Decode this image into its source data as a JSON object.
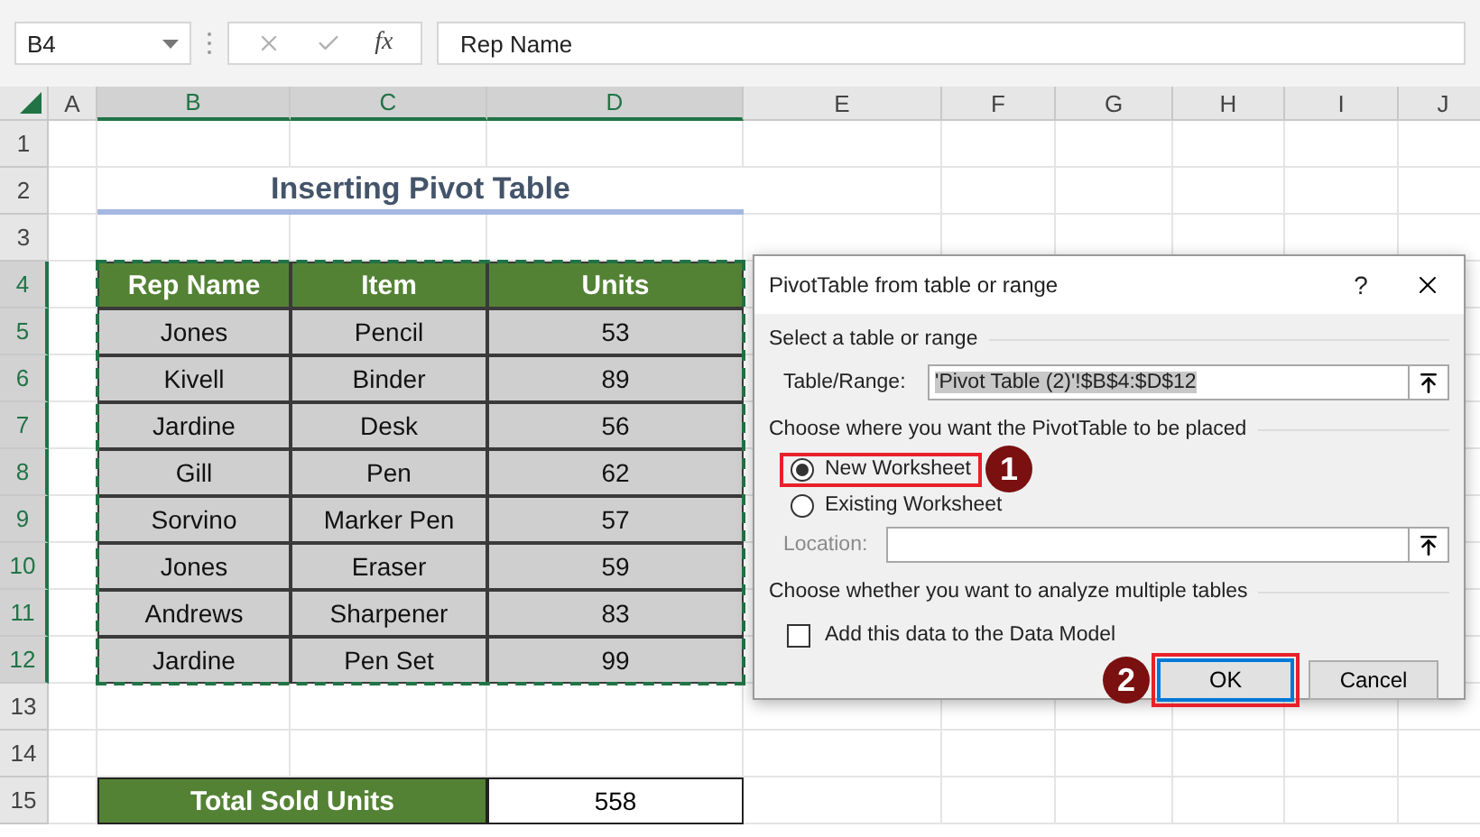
{
  "name_box": "B4",
  "function_label": "fx",
  "formula": "Rep Name",
  "columns": [
    {
      "label": "A",
      "selected": false
    },
    {
      "label": "B",
      "selected": true
    },
    {
      "label": "C",
      "selected": true
    },
    {
      "label": "D",
      "selected": true
    },
    {
      "label": "E",
      "selected": false
    },
    {
      "label": "F",
      "selected": false
    },
    {
      "label": "G",
      "selected": false
    },
    {
      "label": "H",
      "selected": false
    },
    {
      "label": "I",
      "selected": false
    },
    {
      "label": "J",
      "selected": false
    }
  ],
  "rows": [
    {
      "label": "1",
      "selected": false
    },
    {
      "label": "2",
      "selected": false
    },
    {
      "label": "3",
      "selected": false
    },
    {
      "label": "4",
      "selected": true
    },
    {
      "label": "5",
      "selected": true
    },
    {
      "label": "6",
      "selected": true
    },
    {
      "label": "7",
      "selected": true
    },
    {
      "label": "8",
      "selected": true
    },
    {
      "label": "9",
      "selected": true
    },
    {
      "label": "10",
      "selected": true
    },
    {
      "label": "11",
      "selected": true
    },
    {
      "label": "12",
      "selected": true
    },
    {
      "label": "13",
      "selected": false
    },
    {
      "label": "14",
      "selected": false
    },
    {
      "label": "15",
      "selected": false
    }
  ],
  "title": "Inserting Pivot Table",
  "table": {
    "columns": [
      "Rep Name",
      "Item",
      "Units"
    ],
    "rows": [
      [
        "Jones",
        "Pencil",
        "53"
      ],
      [
        "Kivell",
        "Binder",
        "89"
      ],
      [
        "Jardine",
        "Desk",
        "56"
      ],
      [
        "Gill",
        "Pen",
        "62"
      ],
      [
        "Sorvino",
        "Marker Pen",
        "57"
      ],
      [
        "Jones",
        "Eraser",
        "59"
      ],
      [
        "Andrews",
        "Sharpener",
        "83"
      ],
      [
        "Jardine",
        "Pen Set",
        "99"
      ]
    ]
  },
  "total": {
    "label": "Total Sold Units",
    "value": "558"
  },
  "dialog": {
    "title": "PivotTable from table or range",
    "help": "?",
    "section_1": "Select a table or range",
    "range_label": "Table/Range:",
    "range_value": "'Pivot Table (2)'!$B$4:$D$12",
    "section_2": "Choose where you want the PivotTable to be placed",
    "placements": [
      {
        "label": "New Worksheet",
        "selected": true,
        "callout": "1"
      },
      {
        "label": "Existing Worksheet",
        "selected": false
      }
    ],
    "location_label": "Location:",
    "location_disabled": true,
    "section_3": "Choose whether you want to analyze multiple tables",
    "data_model": {
      "label": "Add this data to the Data Model",
      "checked": false
    },
    "ok": {
      "label": "OK",
      "callout": "2"
    },
    "cancel": "Cancel"
  }
}
